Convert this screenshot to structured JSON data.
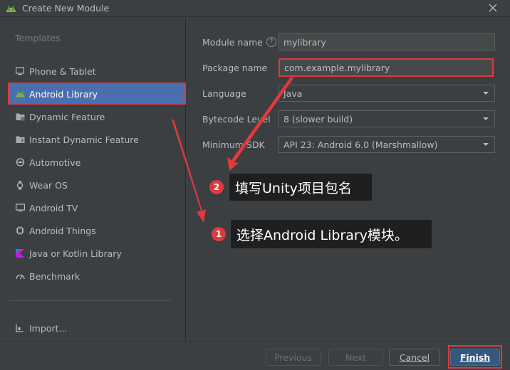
{
  "window": {
    "title": "Create New Module"
  },
  "templates": {
    "section_label": "Templates",
    "items": [
      {
        "label": "Phone & Tablet",
        "icon": "phone-icon"
      },
      {
        "label": "Android Library",
        "icon": "android-icon",
        "selected": true
      },
      {
        "label": "Dynamic Feature",
        "icon": "folder-icon"
      },
      {
        "label": "Instant Dynamic Feature",
        "icon": "folder-icon"
      },
      {
        "label": "Automotive",
        "icon": "car-icon"
      },
      {
        "label": "Wear OS",
        "icon": "watch-icon"
      },
      {
        "label": "Android TV",
        "icon": "tv-icon"
      },
      {
        "label": "Android Things",
        "icon": "chip-icon"
      },
      {
        "label": "Java or Kotlin Library",
        "icon": "kotlin-icon"
      },
      {
        "label": "Benchmark",
        "icon": "gauge-icon"
      }
    ],
    "import_label": "Import..."
  },
  "form": {
    "module_name": {
      "label": "Module name",
      "value": "mylibrary"
    },
    "package_name": {
      "label": "Package name",
      "value": "com.example.mylibrary"
    },
    "language": {
      "label": "Language",
      "value": "Java"
    },
    "bytecode_level": {
      "label": "Bytecode Level",
      "value": "8 (slower build)"
    },
    "minimum_sdk": {
      "label": "Minimum SDK",
      "value": "API 23: Android 6.0 (Marshmallow)"
    }
  },
  "annotations": [
    {
      "number": "2",
      "text": "填写Unity项目包名"
    },
    {
      "number": "1",
      "text": "选择Android Library模块。"
    }
  ],
  "buttons": {
    "previous": "Previous",
    "next": "Next",
    "cancel": "Cancel",
    "finish": "Finish"
  },
  "colors": {
    "accent_selection": "#4b6eaf",
    "highlight": "#e0393e",
    "primary_button": "#365880"
  }
}
